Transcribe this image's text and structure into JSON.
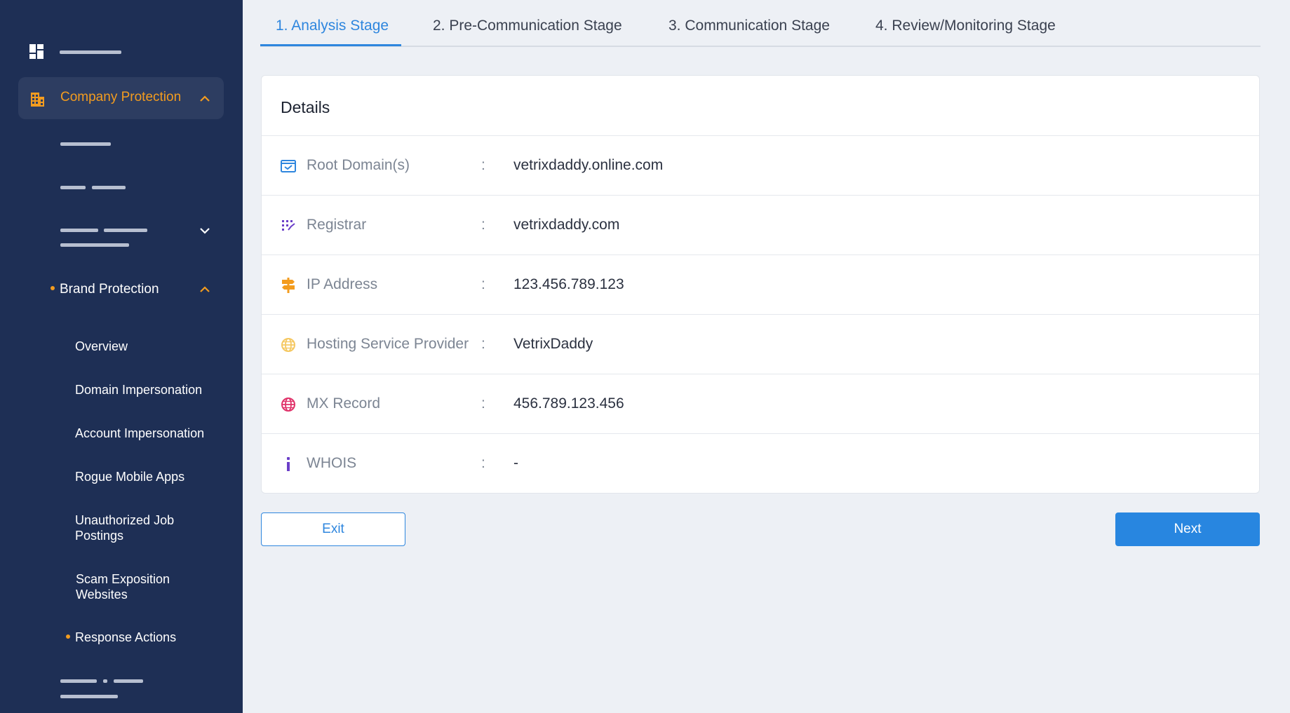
{
  "sidebar": {
    "company_protection": "Company Protection",
    "brand_protection": "Brand Protection",
    "items": [
      {
        "label": "Overview"
      },
      {
        "label": "Domain Impersonation"
      },
      {
        "label": "Account Impersonation"
      },
      {
        "label": "Rogue Mobile Apps"
      },
      {
        "label": "Unauthorized Job Postings"
      },
      {
        "label": "Scam Exposition Websites"
      }
    ],
    "response_actions": "Response Actions"
  },
  "tabs": [
    {
      "label": "1. Analysis Stage"
    },
    {
      "label": "2. Pre-Communication Stage"
    },
    {
      "label": "3. Communication Stage"
    },
    {
      "label": "4. Review/Monitoring Stage"
    }
  ],
  "details": {
    "title": "Details",
    "rows": [
      {
        "label": "Root Domain(s)",
        "value": "vetrixdaddy.online.com",
        "icon": "domain-check-icon",
        "color": "#2e86de"
      },
      {
        "label": "Registrar",
        "value": "vetrixdaddy.com",
        "icon": "registrar-dots-icon",
        "color": "#6b3fc8"
      },
      {
        "label": "IP Address",
        "value": "123.456.789.123",
        "icon": "signpost-icon",
        "color": "#f39c1f"
      },
      {
        "label": "Hosting Service Provider",
        "value": "VetrixDaddy",
        "icon": "globe-icon",
        "color": "#f5c862"
      },
      {
        "label": "MX Record",
        "value": "456.789.123.456",
        "icon": "globe-icon",
        "color": "#e0336a"
      },
      {
        "label": "WHOIS",
        "value": "-",
        "icon": "info-icon",
        "color": "#6b3fc8"
      }
    ]
  },
  "buttons": {
    "exit": "Exit",
    "next": "Next"
  },
  "colors": {
    "sidebar_bg": "#1e2f55",
    "accent": "#2e86de",
    "orange": "#f39c1f"
  }
}
